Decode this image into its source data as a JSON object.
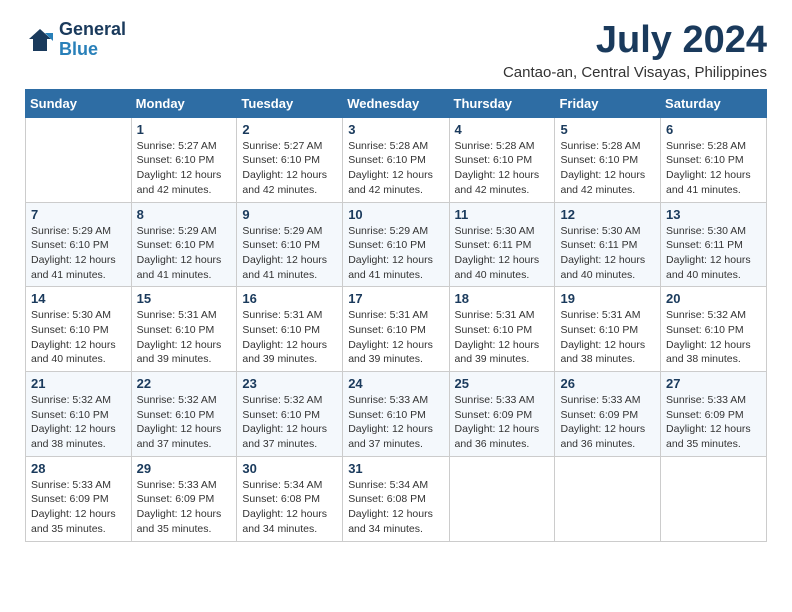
{
  "header": {
    "logo_line1": "General",
    "logo_line2": "Blue",
    "title": "July 2024",
    "subtitle": "Cantao-an, Central Visayas, Philippines"
  },
  "calendar": {
    "days_of_week": [
      "Sunday",
      "Monday",
      "Tuesday",
      "Wednesday",
      "Thursday",
      "Friday",
      "Saturday"
    ],
    "weeks": [
      [
        {
          "day": "",
          "info": ""
        },
        {
          "day": "1",
          "info": "Sunrise: 5:27 AM\nSunset: 6:10 PM\nDaylight: 12 hours\nand 42 minutes."
        },
        {
          "day": "2",
          "info": "Sunrise: 5:27 AM\nSunset: 6:10 PM\nDaylight: 12 hours\nand 42 minutes."
        },
        {
          "day": "3",
          "info": "Sunrise: 5:28 AM\nSunset: 6:10 PM\nDaylight: 12 hours\nand 42 minutes."
        },
        {
          "day": "4",
          "info": "Sunrise: 5:28 AM\nSunset: 6:10 PM\nDaylight: 12 hours\nand 42 minutes."
        },
        {
          "day": "5",
          "info": "Sunrise: 5:28 AM\nSunset: 6:10 PM\nDaylight: 12 hours\nand 42 minutes."
        },
        {
          "day": "6",
          "info": "Sunrise: 5:28 AM\nSunset: 6:10 PM\nDaylight: 12 hours\nand 41 minutes."
        }
      ],
      [
        {
          "day": "7",
          "info": "Sunrise: 5:29 AM\nSunset: 6:10 PM\nDaylight: 12 hours\nand 41 minutes."
        },
        {
          "day": "8",
          "info": "Sunrise: 5:29 AM\nSunset: 6:10 PM\nDaylight: 12 hours\nand 41 minutes."
        },
        {
          "day": "9",
          "info": "Sunrise: 5:29 AM\nSunset: 6:10 PM\nDaylight: 12 hours\nand 41 minutes."
        },
        {
          "day": "10",
          "info": "Sunrise: 5:29 AM\nSunset: 6:10 PM\nDaylight: 12 hours\nand 41 minutes."
        },
        {
          "day": "11",
          "info": "Sunrise: 5:30 AM\nSunset: 6:11 PM\nDaylight: 12 hours\nand 40 minutes."
        },
        {
          "day": "12",
          "info": "Sunrise: 5:30 AM\nSunset: 6:11 PM\nDaylight: 12 hours\nand 40 minutes."
        },
        {
          "day": "13",
          "info": "Sunrise: 5:30 AM\nSunset: 6:11 PM\nDaylight: 12 hours\nand 40 minutes."
        }
      ],
      [
        {
          "day": "14",
          "info": "Sunrise: 5:30 AM\nSunset: 6:10 PM\nDaylight: 12 hours\nand 40 minutes."
        },
        {
          "day": "15",
          "info": "Sunrise: 5:31 AM\nSunset: 6:10 PM\nDaylight: 12 hours\nand 39 minutes."
        },
        {
          "day": "16",
          "info": "Sunrise: 5:31 AM\nSunset: 6:10 PM\nDaylight: 12 hours\nand 39 minutes."
        },
        {
          "day": "17",
          "info": "Sunrise: 5:31 AM\nSunset: 6:10 PM\nDaylight: 12 hours\nand 39 minutes."
        },
        {
          "day": "18",
          "info": "Sunrise: 5:31 AM\nSunset: 6:10 PM\nDaylight: 12 hours\nand 39 minutes."
        },
        {
          "day": "19",
          "info": "Sunrise: 5:31 AM\nSunset: 6:10 PM\nDaylight: 12 hours\nand 38 minutes."
        },
        {
          "day": "20",
          "info": "Sunrise: 5:32 AM\nSunset: 6:10 PM\nDaylight: 12 hours\nand 38 minutes."
        }
      ],
      [
        {
          "day": "21",
          "info": "Sunrise: 5:32 AM\nSunset: 6:10 PM\nDaylight: 12 hours\nand 38 minutes."
        },
        {
          "day": "22",
          "info": "Sunrise: 5:32 AM\nSunset: 6:10 PM\nDaylight: 12 hours\nand 37 minutes."
        },
        {
          "day": "23",
          "info": "Sunrise: 5:32 AM\nSunset: 6:10 PM\nDaylight: 12 hours\nand 37 minutes."
        },
        {
          "day": "24",
          "info": "Sunrise: 5:33 AM\nSunset: 6:10 PM\nDaylight: 12 hours\nand 37 minutes."
        },
        {
          "day": "25",
          "info": "Sunrise: 5:33 AM\nSunset: 6:09 PM\nDaylight: 12 hours\nand 36 minutes."
        },
        {
          "day": "26",
          "info": "Sunrise: 5:33 AM\nSunset: 6:09 PM\nDaylight: 12 hours\nand 36 minutes."
        },
        {
          "day": "27",
          "info": "Sunrise: 5:33 AM\nSunset: 6:09 PM\nDaylight: 12 hours\nand 35 minutes."
        }
      ],
      [
        {
          "day": "28",
          "info": "Sunrise: 5:33 AM\nSunset: 6:09 PM\nDaylight: 12 hours\nand 35 minutes."
        },
        {
          "day": "29",
          "info": "Sunrise: 5:33 AM\nSunset: 6:09 PM\nDaylight: 12 hours\nand 35 minutes."
        },
        {
          "day": "30",
          "info": "Sunrise: 5:34 AM\nSunset: 6:08 PM\nDaylight: 12 hours\nand 34 minutes."
        },
        {
          "day": "31",
          "info": "Sunrise: 5:34 AM\nSunset: 6:08 PM\nDaylight: 12 hours\nand 34 minutes."
        },
        {
          "day": "",
          "info": ""
        },
        {
          "day": "",
          "info": ""
        },
        {
          "day": "",
          "info": ""
        }
      ]
    ]
  }
}
